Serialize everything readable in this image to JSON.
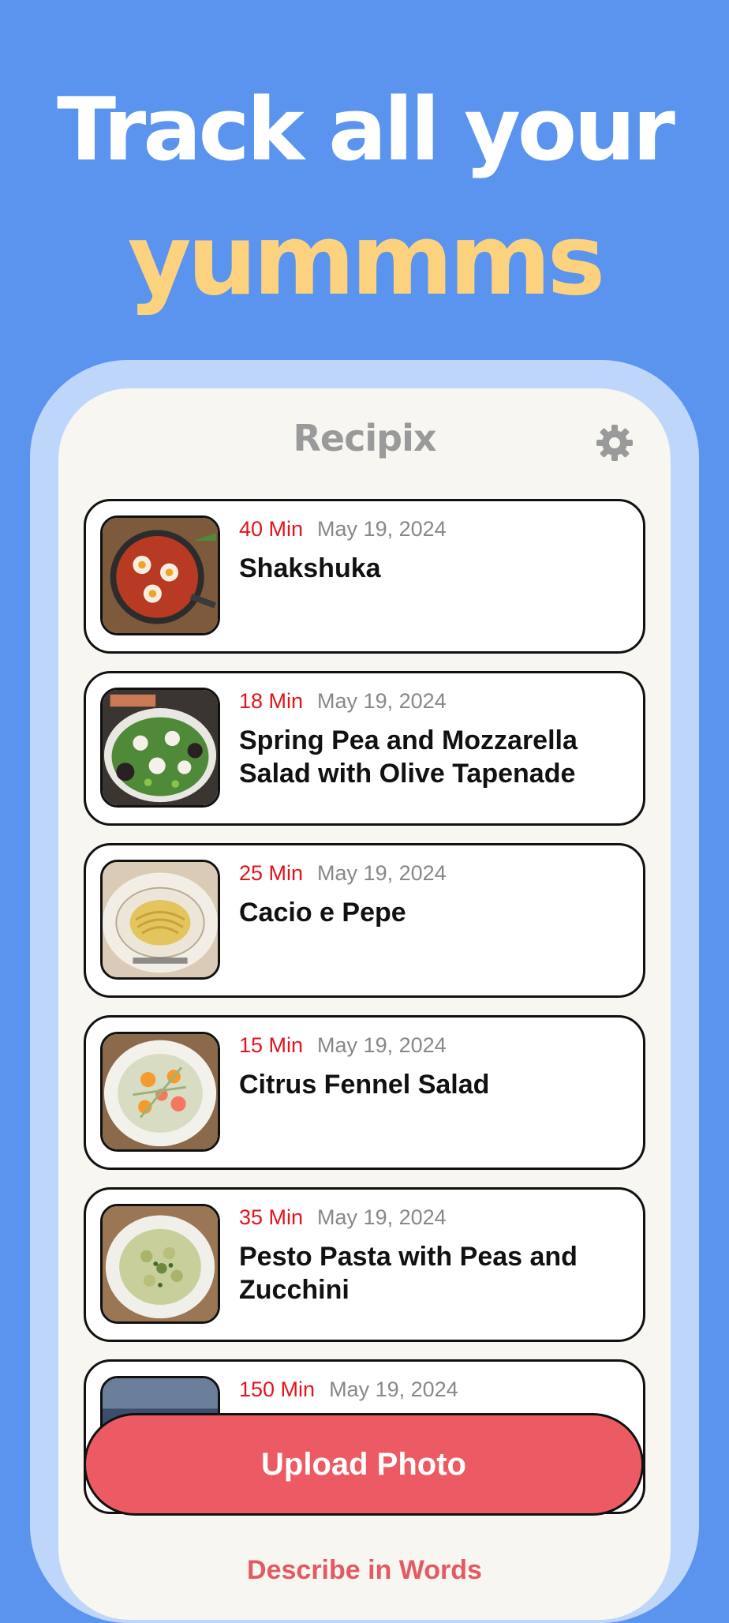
{
  "headline": {
    "line1": "Track all your",
    "line2": "yummms"
  },
  "app": {
    "title": "Recipix",
    "settings_icon": "gear-icon"
  },
  "recipes": [
    {
      "minutes": "40 Min",
      "date": "May 19, 2024",
      "title": "Shakshuka"
    },
    {
      "minutes": "18 Min",
      "date": "May 19, 2024",
      "title": "Spring Pea and Mozzarella Salad with Olive Tapenade"
    },
    {
      "minutes": "25 Min",
      "date": "May 19, 2024",
      "title": "Cacio e Pepe"
    },
    {
      "minutes": "15 Min",
      "date": "May 19, 2024",
      "title": "Citrus Fennel Salad"
    },
    {
      "minutes": "35 Min",
      "date": "May 19, 2024",
      "title": "Pesto Pasta with Peas and Zucchini"
    },
    {
      "minutes": "150 Min",
      "date": "May 19, 2024",
      "title": ""
    }
  ],
  "actions": {
    "upload_label": "Upload Photo",
    "describe_label": "Describe in Words"
  },
  "colors": {
    "background": "#5b94ee",
    "headline_accent": "#fdd27e",
    "minutes": "#e3131b",
    "upload_button": "#ec5b64"
  }
}
